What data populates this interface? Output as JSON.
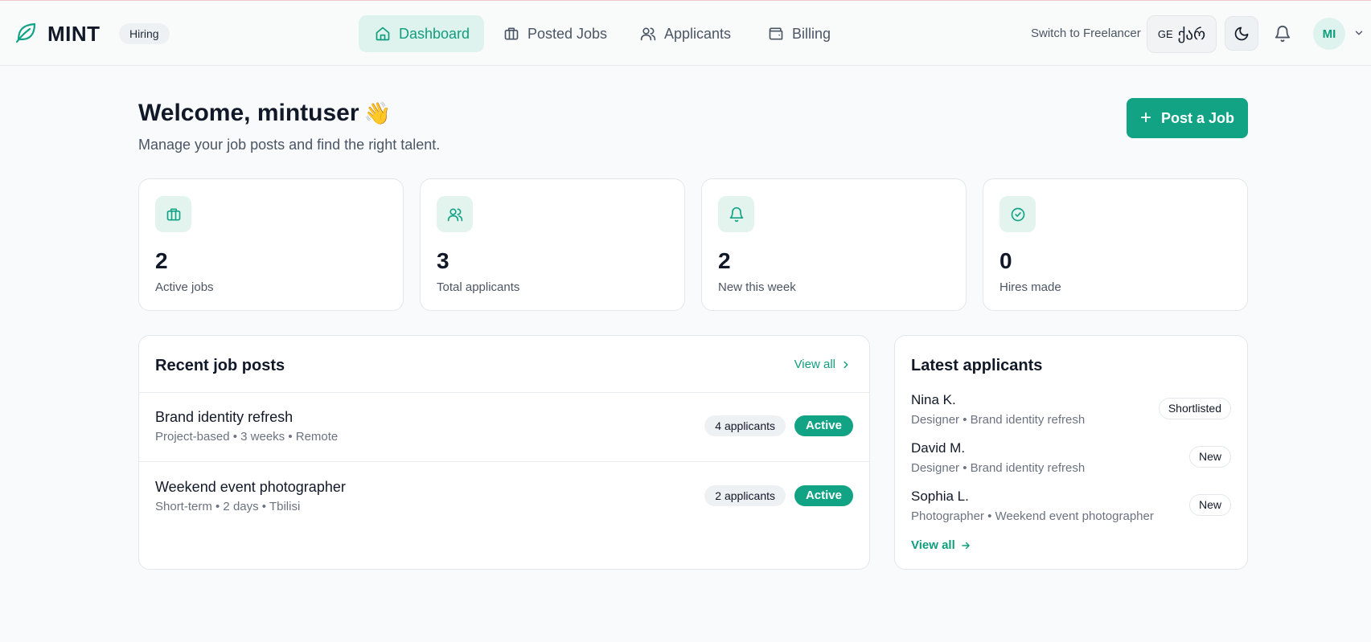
{
  "header": {
    "brand": "MINT",
    "role_badge": "Hiring",
    "nav": [
      {
        "label": "Dashboard",
        "icon": "home-icon",
        "active": true
      },
      {
        "label": "Posted Jobs",
        "icon": "briefcase-icon",
        "active": false
      },
      {
        "label": "Applicants",
        "icon": "users-icon",
        "active": false
      },
      {
        "label": "Billing",
        "icon": "wallet-icon",
        "active": false
      }
    ],
    "switch_link": "Switch to Freelancer",
    "language": {
      "code": "GE",
      "native": "ქარ"
    },
    "avatar_initials": "MI"
  },
  "welcome": {
    "title": "Welcome, mintuser",
    "emoji": "👋",
    "subtitle": "Manage your job posts and find the right talent.",
    "post_job_label": "Post a Job"
  },
  "stats": [
    {
      "value": "2",
      "label": "Active jobs",
      "icon": "briefcase-icon"
    },
    {
      "value": "3",
      "label": "Total applicants",
      "icon": "users-icon"
    },
    {
      "value": "2",
      "label": "New this week",
      "icon": "bell-icon"
    },
    {
      "value": "0",
      "label": "Hires made",
      "icon": "check-circle-icon"
    }
  ],
  "recent_jobs": {
    "title": "Recent job posts",
    "view_all": "View all",
    "items": [
      {
        "title": "Brand identity refresh",
        "meta": "Project-based • 3 weeks • Remote",
        "applicants": "4 applicants",
        "status": "Active"
      },
      {
        "title": "Weekend event photographer",
        "meta": "Short-term • 2 days • Tbilisi",
        "applicants": "2 applicants",
        "status": "Active"
      }
    ]
  },
  "latest_applicants": {
    "title": "Latest applicants",
    "view_all": "View all",
    "items": [
      {
        "name": "Nina K.",
        "meta": "Designer • Brand identity refresh",
        "status": "Shortlisted"
      },
      {
        "name": "David M.",
        "meta": "Designer • Brand identity refresh",
        "status": "New"
      },
      {
        "name": "Sophia L.",
        "meta": "Photographer • Weekend event photographer",
        "status": "New"
      }
    ]
  },
  "colors": {
    "accent": "#12a385",
    "accent_soft": "#dff3ee",
    "background": "#f8fafb"
  }
}
